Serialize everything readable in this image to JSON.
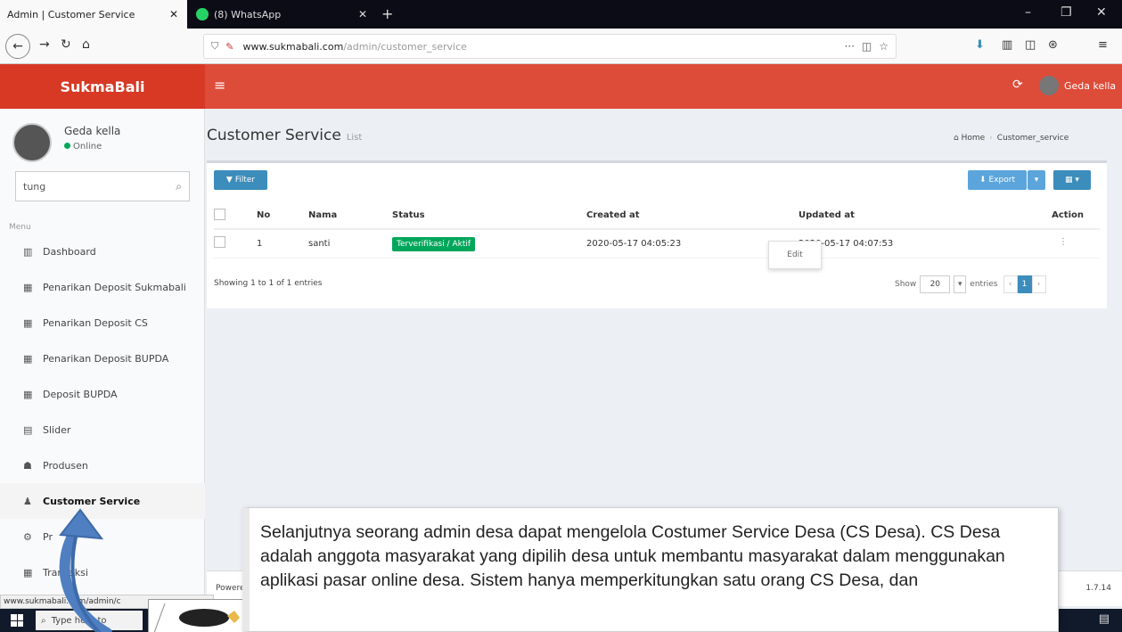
{
  "browser": {
    "tabs": [
      {
        "title": "Admin | Customer Service",
        "active": true
      },
      {
        "title": "(8) WhatsApp",
        "active": false
      }
    ],
    "url_domain": "www.sukmabali.com",
    "url_path": "/admin/customer_service",
    "url_more": "···"
  },
  "header": {
    "brand": "SukmaBali",
    "menu_glyph": "≡",
    "user_name": "Geda kella"
  },
  "sidebar": {
    "user_name": "Geda kella",
    "user_status": "Online",
    "search_value": "tung",
    "menu_header": "Menu",
    "items": [
      {
        "label": "Dashboard",
        "icon": "▥"
      },
      {
        "label": "Penarikan Deposit Sukmabali",
        "icon": "▦"
      },
      {
        "label": "Penarikan Deposit CS",
        "icon": "▦"
      },
      {
        "label": "Penarikan Deposit BUPDA",
        "icon": "▦"
      },
      {
        "label": "Deposit BUPDA",
        "icon": "▦"
      },
      {
        "label": "Slider",
        "icon": "▤"
      },
      {
        "label": "Produsen",
        "icon": "☗"
      },
      {
        "label": "Customer Service",
        "icon": "♟"
      },
      {
        "label": "Pr",
        "icon": "⚙"
      },
      {
        "label": "Transaksi",
        "icon": "▦"
      }
    ]
  },
  "content": {
    "title": "Customer Service",
    "subtitle": "List",
    "breadcrumb": [
      "Home",
      "Customer_service"
    ],
    "filter_label": "Filter",
    "export_label": "Export",
    "columns": [
      "No",
      "Nama",
      "Status",
      "Created at",
      "Updated at",
      "Action"
    ],
    "rows": [
      {
        "no": "1",
        "nama": "santi",
        "status": "Terverifikasi / Aktif",
        "created": "2020-05-17 04:05:23",
        "updated": "2020-05-17 04:07:53"
      }
    ],
    "edit_label": "Edit",
    "showing": "Showing 1 to 1 of 1 entries",
    "length_show": "Show",
    "length_value": "20",
    "length_entries": "entries",
    "current_page": "1"
  },
  "footer": {
    "left": "Powered",
    "right": "1.7.14"
  },
  "status_url": "www.sukmabali.com/admin/c",
  "taskbar_search": "Type here to",
  "callout_text": "Selanjutnya seorang admin desa dapat mengelola Costumer Service Desa (CS Desa). CS Desa adalah anggota masyarakat yang dipilih desa untuk membantu masyarakat dalam menggunakan aplikasi pasar online desa. Sistem hanya memperkitungkan satu orang CS Desa, dan"
}
